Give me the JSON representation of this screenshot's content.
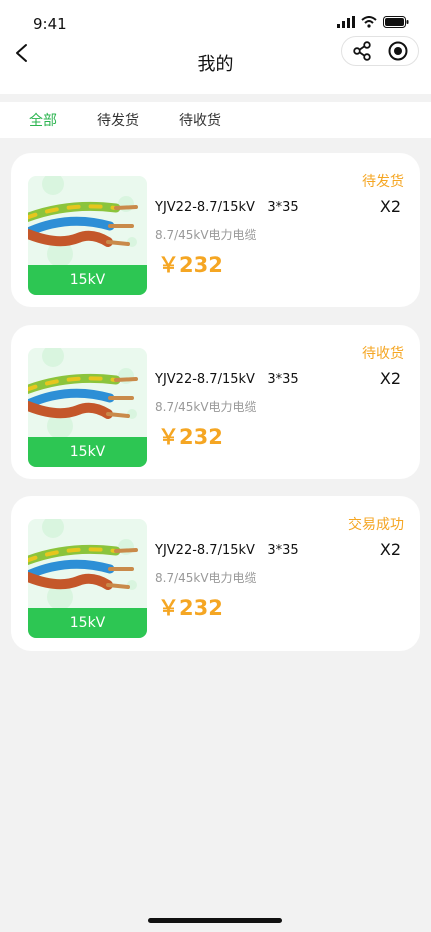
{
  "status_bar": {
    "time": "9:41"
  },
  "header": {
    "title": "我的"
  },
  "tabs": [
    {
      "label": "全部",
      "active": true
    },
    {
      "label": "待发货",
      "active": false
    },
    {
      "label": "待收货",
      "active": false
    }
  ],
  "orders": [
    {
      "status": "待发货",
      "quantity": "X2",
      "name": "YJV22-8.7/15kV   3*35",
      "desc": "8.7/45kV电力电缆",
      "price": "￥232",
      "image_label": "15kV"
    },
    {
      "status": "待收货",
      "quantity": "X2",
      "name": "YJV22-8.7/15kV   3*35",
      "desc": "8.7/45kV电力电缆",
      "price": "￥232",
      "image_label": "15kV"
    },
    {
      "status": "交易成功",
      "quantity": "X2",
      "name": "YJV22-8.7/15kV   3*35",
      "desc": "8.7/45kV电力电缆",
      "price": "￥232",
      "image_label": "15kV"
    }
  ],
  "colors": {
    "accent": "#2bb44f",
    "status": "#f5a623",
    "price": "#f5a623",
    "label_bg": "#2dc653"
  }
}
